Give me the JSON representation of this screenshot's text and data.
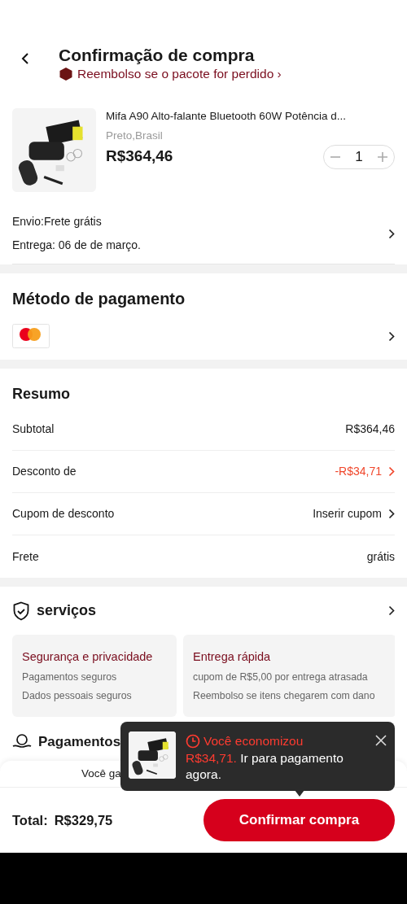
{
  "header": {
    "title": "Confirmação de compra",
    "subtitle": "Reembolso se o pacote for perdido ›"
  },
  "product": {
    "title": "Mifa A90 Alto-falante Bluetooth 60W Potência d...",
    "variant": "Preto,Brasil",
    "price": "R$364,46",
    "quantity": "1"
  },
  "shipping": {
    "line_1": "Envio:Frete grátis",
    "line_2": "Entrega: 06 de de março."
  },
  "payment": {
    "title": "Método de pagamento"
  },
  "summary": {
    "title": "Resumo",
    "rows": [
      {
        "label": "Subtotal",
        "value": "R$364,46",
        "kind": "plain"
      },
      {
        "label": "Desconto de",
        "value": "-R$34,71",
        "kind": "discount"
      },
      {
        "label": "Cupom de desconto",
        "value": "Inserir cupom",
        "kind": "link"
      },
      {
        "label": "Frete",
        "value": "grátis",
        "kind": "plain"
      }
    ]
  },
  "services": {
    "title": "serviços",
    "cards": [
      {
        "title": "Segurança e privacidade",
        "lines": [
          "Pagamentos seguros",
          "Dados pessoais seguros"
        ]
      },
      {
        "title": "Entrega rápida",
        "lines": [
          "cupom de R$5,00 por entrega atrasada",
          "Reembolso se itens chegarem com dano"
        ]
      }
    ]
  },
  "installments": {
    "title": "Pagamentos"
  },
  "credits": {
    "left": "Você ga"
  },
  "footer": {
    "total_label": "Total:",
    "total_value": "R$329,75",
    "button": "Confirmar compra"
  },
  "toast": {
    "title": "Você economizou",
    "amount": "R$34,71.",
    "text": "Ir para pagamento agora."
  }
}
